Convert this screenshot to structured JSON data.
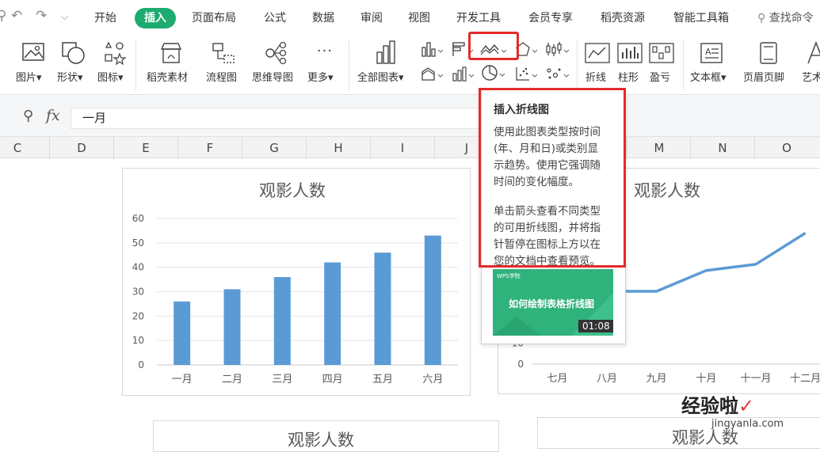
{
  "menubar": {
    "items": [
      "开始",
      "插入",
      "页面布局",
      "公式",
      "数据",
      "审阅",
      "视图",
      "开发工具",
      "会员专享",
      "稻壳资源",
      "智能工具箱"
    ],
    "search": "查找命令"
  },
  "ribbon": {
    "picture": "图片",
    "shape": "形状",
    "icon": "图标",
    "docer_material": "稻壳素材",
    "flowchart": "流程图",
    "mindmap": "思维导图",
    "more": "更多",
    "all_charts": "全部图表",
    "sparkline_line": "折线",
    "sparkline_column": "柱形",
    "sparkline_winloss": "盈亏",
    "textbox": "文本框",
    "header_footer": "页眉页脚",
    "art_text": "艺术"
  },
  "formula": {
    "fx": "fx",
    "value": "一月"
  },
  "columns": [
    "C",
    "D",
    "E",
    "F",
    "G",
    "H",
    "I",
    "J",
    "M",
    "N",
    "O"
  ],
  "tooltip": {
    "title": "插入折线图",
    "lines": [
      "使用此图表类型按时间",
      "(年、月和日)或类别显",
      "示趋势。使用它强调随",
      "时间的变化幅度。",
      "",
      "单击箭头查看不同类型",
      "的可用折线图，并将指",
      "针暂停在图标上方以在",
      "您的文档中查看预览。"
    ],
    "video_title": "如何绘制表格折线图",
    "video_duration": "01:08",
    "video_brand": "WPS学院"
  },
  "watermark": {
    "main": "经验啦",
    "sub": "jingyanla.com"
  },
  "chart_data": [
    {
      "type": "bar",
      "title": "观影人数",
      "categories": [
        "一月",
        "二月",
        "三月",
        "四月",
        "五月",
        "六月"
      ],
      "values": [
        26,
        31,
        36,
        42,
        46,
        53
      ],
      "ylim": [
        0,
        60
      ],
      "yticks": [
        "0",
        "10",
        "20",
        "30",
        "40",
        "50",
        "60"
      ],
      "color": "#5b9bd5"
    },
    {
      "type": "line",
      "title": "观影人数",
      "categories": [
        "七月",
        "八月",
        "九月",
        "十月",
        "十一月",
        "十二月"
      ],
      "values": [
        35,
        35,
        35,
        45,
        48,
        63
      ],
      "ylim": [
        0,
        70
      ],
      "yticks": [
        "0",
        "10"
      ],
      "color": "#5b9bd5"
    }
  ],
  "bottom_charts": {
    "left_title": "观影人数",
    "right_title": "观影人数"
  }
}
